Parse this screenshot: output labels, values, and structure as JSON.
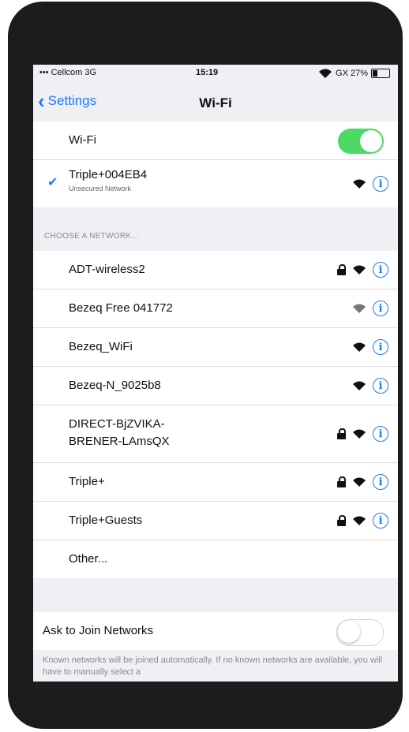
{
  "status_bar": {
    "carrier": "••• Cellcom 3G",
    "time": "15:19",
    "right": "GX 27%"
  },
  "nav": {
    "back_label": "Settings",
    "title": "Wi-Fi"
  },
  "wifi_toggle": {
    "label": "Wi-Fi",
    "state": "on"
  },
  "connected": {
    "name": "Triple+004EB4",
    "subtitle": "Unsecured Network"
  },
  "section_header": "CHOOSE A NETWORK...",
  "networks": [
    {
      "name": "ADT-wireless2",
      "locked": true
    },
    {
      "name": "Bezeq Free 041772",
      "locked": false
    },
    {
      "name": "Bezeq_WiFi",
      "locked": false
    },
    {
      "name": "Bezeq-N_9025b8",
      "locked": false
    },
    {
      "name_line1": "DIRECT-BjZVIKA-",
      "name_line2": "BRENER-LAmsQX",
      "locked": true
    },
    {
      "name": "Triple+",
      "locked": true
    },
    {
      "name": "Triple+Guests",
      "locked": true
    },
    {
      "name": "Other..."
    }
  ],
  "ask_to_join": {
    "label": "Ask to Join Networks",
    "state": "off"
  },
  "footer_text": "Known networks will be joined automatically. If no known networks are available, you will have to manually select a",
  "info_glyph": "i",
  "colors": {
    "accent": "#1e7cf4",
    "toggle_on": "#4cd964",
    "background": "#efeff4",
    "phone": "#1c1c1c"
  }
}
